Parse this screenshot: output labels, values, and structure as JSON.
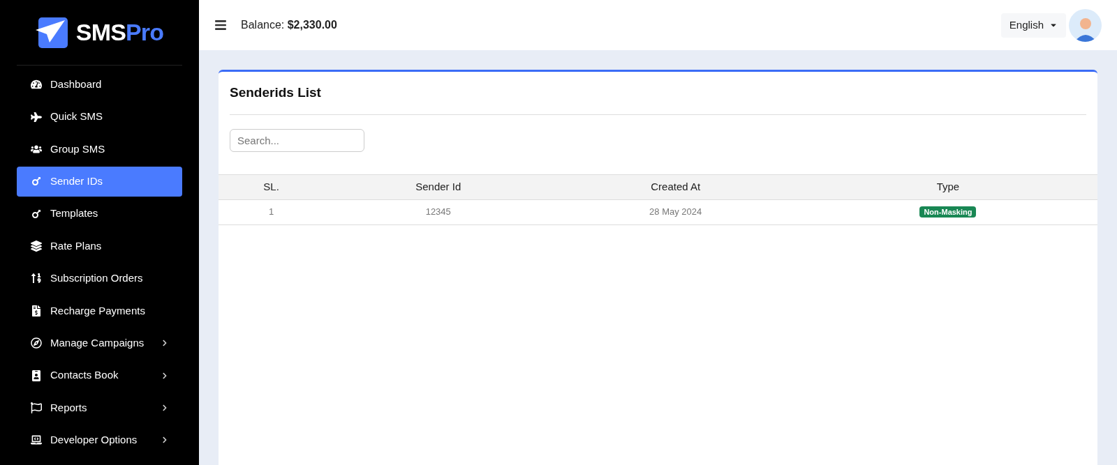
{
  "brand": {
    "name_first": "SMS",
    "name_second": "Pro"
  },
  "sidebar": {
    "items": [
      {
        "label": "Dashboard",
        "selected": false,
        "expandable": false
      },
      {
        "label": "Quick SMS",
        "selected": false,
        "expandable": false
      },
      {
        "label": "Group SMS",
        "selected": false,
        "expandable": false
      },
      {
        "label": "Sender IDs",
        "selected": true,
        "expandable": false
      },
      {
        "label": "Templates",
        "selected": false,
        "expandable": false
      },
      {
        "label": "Rate Plans",
        "selected": false,
        "expandable": false
      },
      {
        "label": "Subscription Orders",
        "selected": false,
        "expandable": false
      },
      {
        "label": "Recharge Payments",
        "selected": false,
        "expandable": false
      },
      {
        "label": "Manage Campaigns",
        "selected": false,
        "expandable": true
      },
      {
        "label": "Contacts Book",
        "selected": false,
        "expandable": true
      },
      {
        "label": "Reports",
        "selected": false,
        "expandable": true
      },
      {
        "label": "Developer Options",
        "selected": false,
        "expandable": true
      }
    ]
  },
  "header": {
    "balance_label": "Balance:",
    "balance_value": "$2,330.00",
    "language": "English"
  },
  "card": {
    "title": "Senderids List",
    "search": {
      "placeholder": "Search..."
    },
    "table": {
      "columns": [
        "SL.",
        "Sender Id",
        "Created At",
        "Type"
      ],
      "rows": [
        {
          "sl": "1",
          "sender_id": "12345",
          "created_at": "28 May 2024",
          "type": {
            "label": "Non-Masking",
            "color": "#198754"
          }
        }
      ]
    }
  }
}
